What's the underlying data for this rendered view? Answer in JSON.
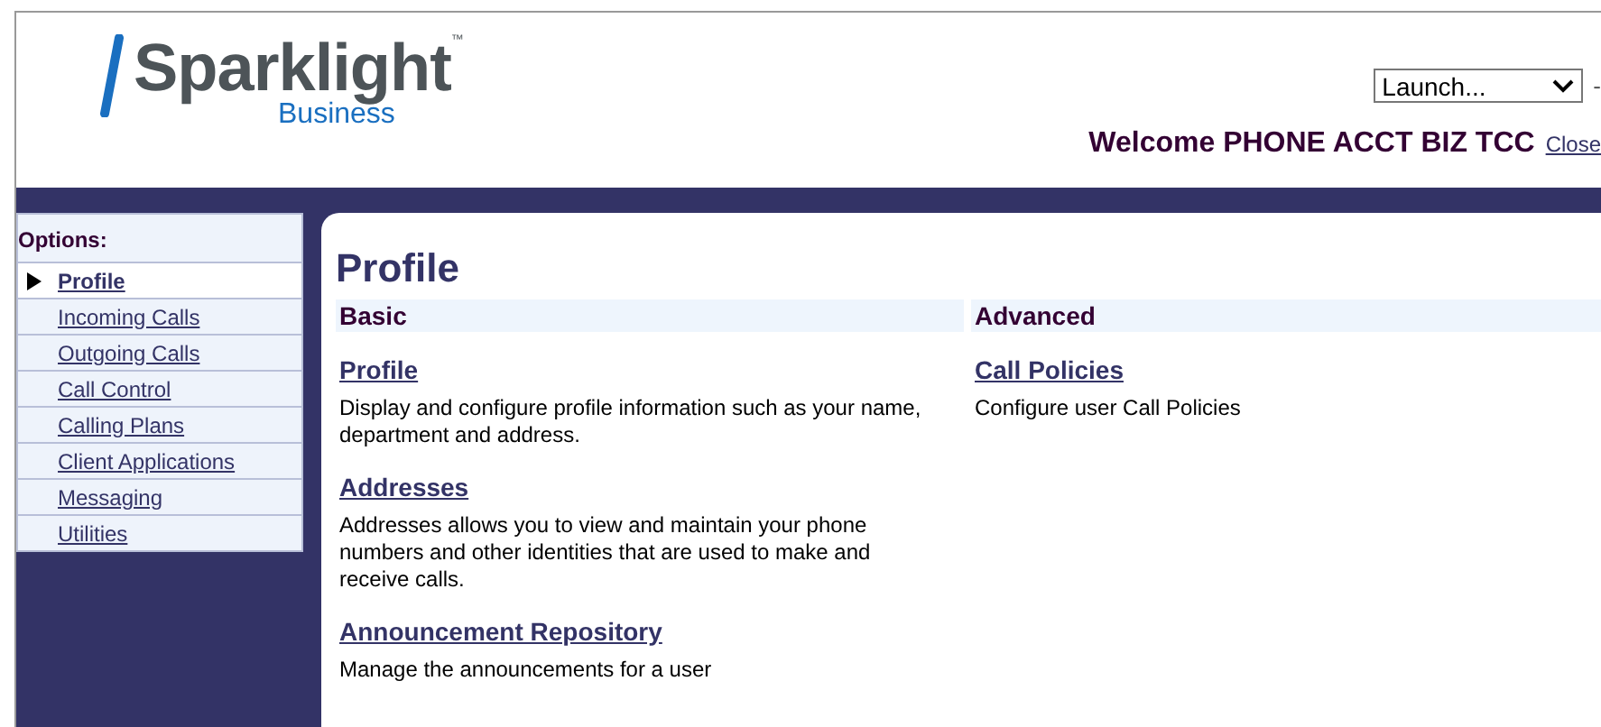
{
  "header": {
    "logo": {
      "name": "Sparklight",
      "mark": "™",
      "sub": "Business"
    },
    "launch": {
      "value": "Launch..."
    },
    "separator": "-",
    "welcome": "Welcome PHONE ACCT BIZ TCC",
    "close_link": "Close"
  },
  "sidebar": {
    "title": "Options:",
    "items": [
      {
        "label": "Profile",
        "selected": true
      },
      {
        "label": "Incoming Calls",
        "selected": false
      },
      {
        "label": "Outgoing Calls",
        "selected": false
      },
      {
        "label": "Call Control",
        "selected": false
      },
      {
        "label": "Calling Plans",
        "selected": false
      },
      {
        "label": "Client Applications",
        "selected": false
      },
      {
        "label": "Messaging",
        "selected": false
      },
      {
        "label": "Utilities",
        "selected": false
      }
    ]
  },
  "page": {
    "title": "Profile",
    "columns": [
      {
        "heading": "Basic",
        "entries": [
          {
            "link": "Profile",
            "description": "Display and configure profile information such as your name, department and address."
          },
          {
            "link": "Addresses",
            "description": "Addresses allows you to view and maintain your phone numbers and other identities that are used to make and receive calls."
          },
          {
            "link": "Announcement Repository",
            "description": "Manage the announcements for a user"
          }
        ]
      },
      {
        "heading": "Advanced",
        "entries": [
          {
            "link": "Call Policies",
            "description": "Configure user Call Policies"
          }
        ]
      }
    ]
  }
}
